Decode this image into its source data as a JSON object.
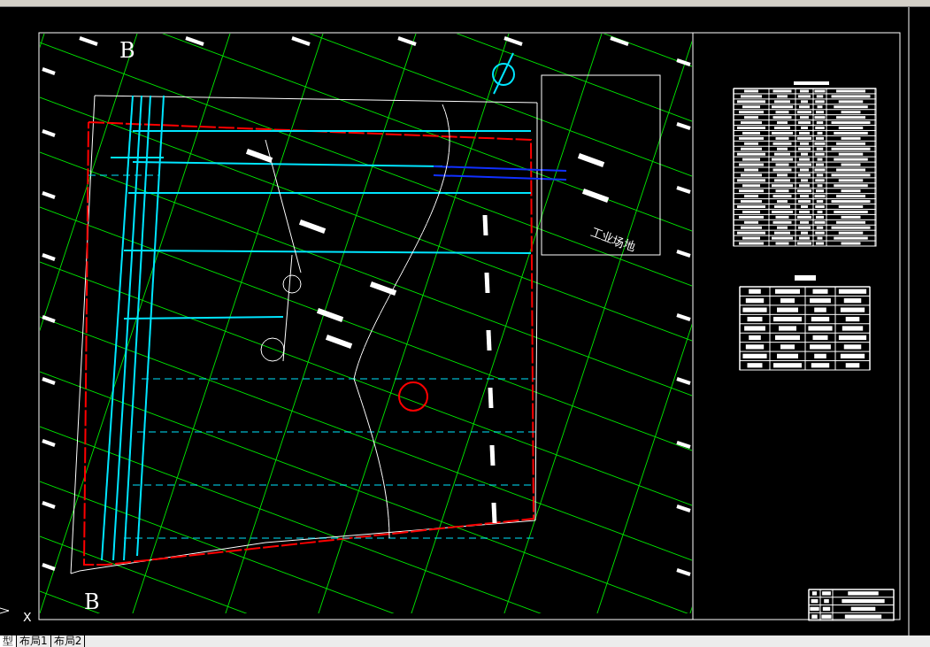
{
  "drawing": {
    "section_labels": [
      {
        "text": "B"
      },
      {
        "text": "B"
      }
    ],
    "site_label": "工业场地"
  },
  "ucs_icon": {
    "axis_label": "X"
  },
  "layout_tabs": [
    {
      "label": "型",
      "selected": true
    },
    {
      "label": "布局1",
      "selected": false
    },
    {
      "label": "布局2",
      "selected": false
    }
  ]
}
